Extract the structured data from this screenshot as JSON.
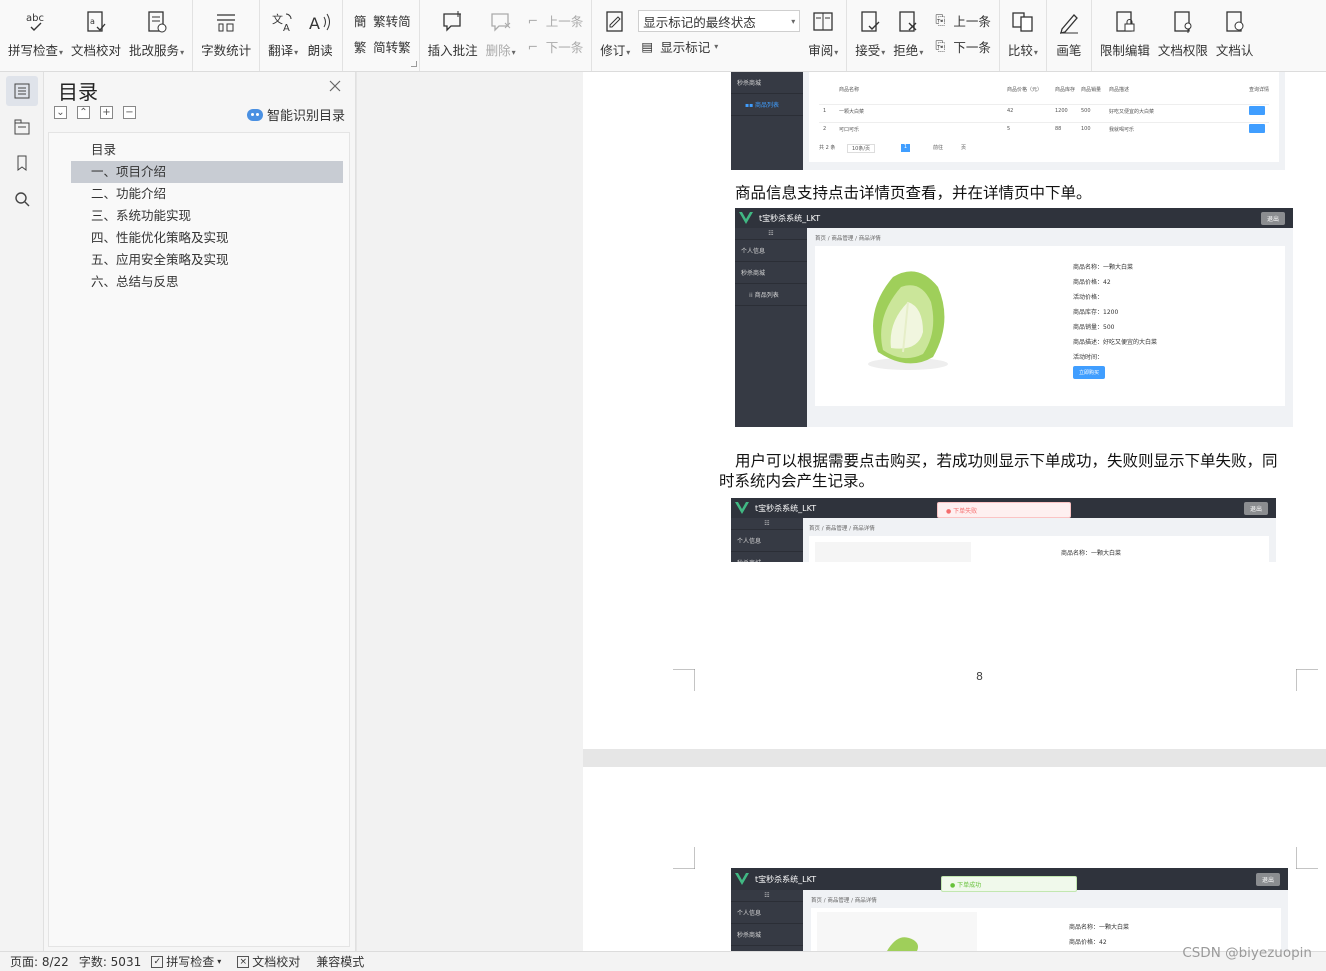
{
  "ribbon": {
    "spell_check": "拼写检查",
    "doc_proof": "文档校对",
    "review_service": "批改服务",
    "word_count": "字数统计",
    "translate": "翻译",
    "read_aloud": "朗读",
    "trad_to_simp": "繁转简",
    "simp_to_trad": "简转繁",
    "insert_comment": "插入批注",
    "delete": "删除",
    "prev_comment": "上一条",
    "next_comment": "下一条",
    "revise": "修订",
    "markup_mode": "显示标记的最终状态",
    "show_markup": "显示标记",
    "review": "审阅",
    "accept": "接受",
    "reject": "拒绝",
    "prev_change": "上一条",
    "next_change": "下一条",
    "compare": "比较",
    "ink": "画笔",
    "restrict_edit": "限制编辑",
    "doc_permission": "文档权限",
    "doc_cert": "文档认"
  },
  "toc": {
    "title": "目录",
    "smart_label": "智能识别目录",
    "items": [
      {
        "label": "目录"
      },
      {
        "label": "一、项目介绍"
      },
      {
        "label": "二、功能介绍"
      },
      {
        "label": "三、系统功能实现"
      },
      {
        "label": "四、性能优化策略及实现"
      },
      {
        "label": "五、应用安全策略及实现"
      },
      {
        "label": "六、总结与反思"
      }
    ],
    "selected_index": 1
  },
  "document": {
    "para1": "商品信息支持点击详情页查看，并在详情页中下单。",
    "para2_line1": "用户可以根据需要点击购买，若成功则显示下单成功，失败则显示下单失败，同",
    "para2_line2": "时系统内会产生记录。",
    "page_number": "8",
    "app_title": "t宝秒杀系统_LKT",
    "exit": "退出",
    "sidebar": {
      "personal": "个人信息",
      "mall": "秒杀商城",
      "product_list": "商品列表",
      "nav": "☷"
    },
    "breadcrumb": {
      "home": "首页",
      "manage": "商品管理",
      "detail": "商品详情"
    },
    "detail": {
      "name": "商品名称：一颗大白菜",
      "price": "商品价格：42",
      "activity_price": "活动价格：",
      "stock": "商品库存：1200",
      "sales": "商品销量：500",
      "desc": "商品描述：好吃又便宜的大白菜",
      "activity_time": "活动时间：",
      "buy": "立即购买"
    },
    "toast_fail": "下单失败",
    "toast_success": "下单成功",
    "table": {
      "headers": [
        "商品名称",
        "商品价格（元）",
        "商品库存",
        "商品销量",
        "商品描述",
        "查询详情"
      ],
      "rows": [
        [
          "1",
          "一颗大白菜",
          "42",
          "1200",
          "500",
          "好吃又便宜的大白菜"
        ],
        [
          "2",
          "可口可乐",
          "5",
          "88",
          "100",
          "我就喝可乐"
        ]
      ],
      "pager_total": "共 2 条",
      "pager_size": "10条/页",
      "pager_goto": "前往",
      "pager_page": "1",
      "pager_unit": "页"
    }
  },
  "status": {
    "page": "页面: 8/22",
    "words": "字数: 5031",
    "spell": "拼写检查",
    "proof": "文档校对",
    "compat": "兼容模式"
  },
  "watermark": "CSDN @biyezuopin",
  "colors": {
    "accent": "#409eff",
    "topbar": "#2f333c",
    "sidebar": "#363a44",
    "logo_green": "#41b883",
    "toc_selected": "#c8ccd3"
  }
}
